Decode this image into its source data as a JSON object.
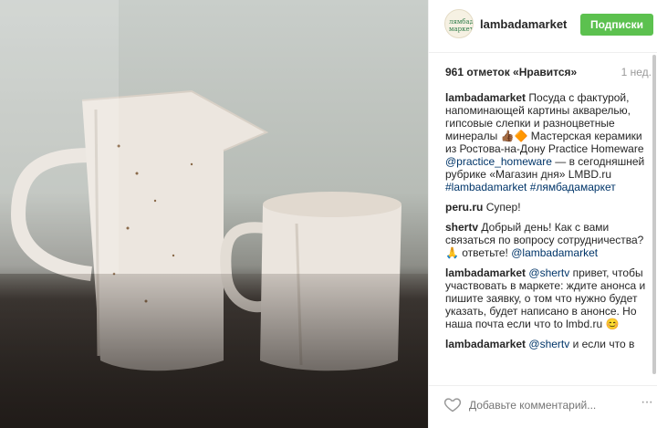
{
  "header": {
    "username": "lambadamarket",
    "follow_label": "Подписки",
    "avatar_text": "лямбада маркет"
  },
  "post": {
    "likes": "961 отметок «Нравится»",
    "time_ago": "1 нед."
  },
  "comments": [
    {
      "user": "lambadamarket",
      "text": "Посуда с фактурой, напоминающей картины акварелью, гипсовые слепки и разноцветные минералы 👍🏾🔶 Мастерская керамики из Ростова-на-Дону Practice Homeware ",
      "link1": "@practice_homeware",
      "text2": " — в сегодняшней рубрике «Магазин дня» LMBD.ru ",
      "link2": "#lambadamarket",
      "link3": "#лямбадамаркет"
    },
    {
      "user": "peru.ru",
      "text": "Супер!"
    },
    {
      "user": "shertv",
      "text": "Добрый день! Как с вами связаться по вопросу сотрудничества? 🙏 ответьте! ",
      "link1": "@lambadamarket"
    },
    {
      "user": "lambadamarket",
      "link1": "@shertv",
      "text": " привет, чтобы участвовать в маркете: ждите анонса и пишите заявку, о том что нужно будет указать, будет написано в анонсе. Но наша почта если что to lmbd.ru 😊"
    },
    {
      "user": "lambadamarket",
      "link1": "@shertv",
      "text": " и если что в"
    }
  ],
  "footer": {
    "comment_placeholder": "Добавьте комментарий...",
    "more_label": "···"
  },
  "colors": {
    "follow": "#5cc14f",
    "link": "#003569"
  }
}
